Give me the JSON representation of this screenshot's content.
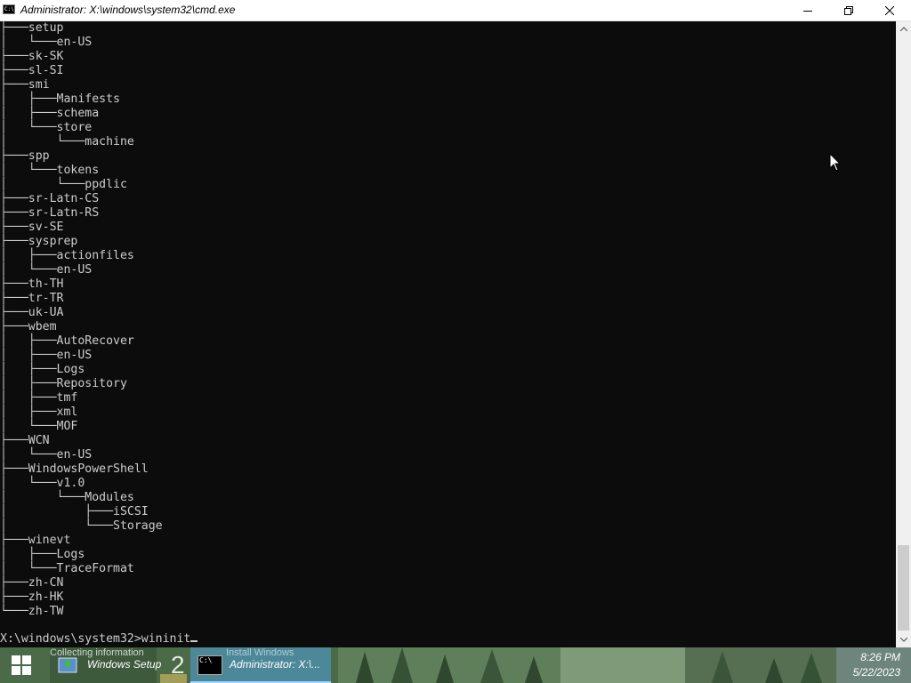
{
  "window": {
    "title": "Administrator: X:\\windows\\system32\\cmd.exe",
    "icon_text": "C:\\",
    "controls": [
      "minimize-icon",
      "restore-icon",
      "close-icon"
    ]
  },
  "console": {
    "tree_lines": [
      "├───setup",
      "│   └───en-US",
      "├───sk-SK",
      "├───sl-SI",
      "├───smi",
      "│   ├───Manifests",
      "│   ├───schema",
      "│   └───store",
      "│       └───machine",
      "├───spp",
      "│   └───tokens",
      "│       └───ppdlic",
      "├───sr-Latn-CS",
      "├───sr-Latn-RS",
      "├───sv-SE",
      "├───sysprep",
      "│   ├───actionfiles",
      "│   └───en-US",
      "├───th-TH",
      "├───tr-TR",
      "├───uk-UA",
      "├───wbem",
      "│   ├───AutoRecover",
      "│   ├───en-US",
      "│   ├───Logs",
      "│   ├───Repository",
      "│   ├───tmf",
      "│   ├───xml",
      "│   └───MOF",
      "├───WCN",
      "│   └───en-US",
      "├───WindowsPowerShell",
      "│   └───v1.0",
      "│       └───Modules",
      "│           ├───iSCSI",
      "│           └───Storage",
      "├───winevt",
      "│   ├───Logs",
      "│   └───TraceFormat",
      "├───zh-CN",
      "├───zh-HK",
      "└───zh-TW"
    ],
    "blank_line": "",
    "prompt": "X:\\windows\\system32>",
    "command": "wininit"
  },
  "taskbar": {
    "start_icon": "windows-logo-icon",
    "setup_label": "Windows Setup",
    "setup_overlay": "Collecting information",
    "group_number": "2",
    "cmd_label": "Administrator: X:\\...",
    "cmd_overlay": "Install Windows",
    "time": "8:26 PM",
    "date": "5/22/2023"
  },
  "colors": {
    "console_bg": "#0c0c0c",
    "console_fg": "#cccccc",
    "titlebar_bg": "#ffffff",
    "taskbar_active": "#5aa0dc"
  }
}
